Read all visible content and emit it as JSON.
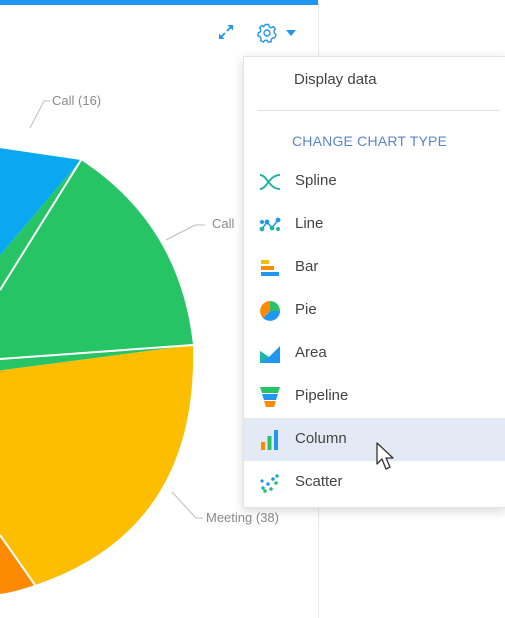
{
  "toolbar": {
    "expand_icon": "expand-icon",
    "settings_icon": "gear-icon",
    "dropdown_icon": "caret-down-icon",
    "accent_color": "#2196f3"
  },
  "chart_data": {
    "type": "pie",
    "labels": [
      "Call (16)",
      "Call",
      "Meeting (38)"
    ],
    "slices": [
      {
        "name": "Call (16)",
        "color": "#0aa8f0"
      },
      {
        "name": "Call",
        "color": "#27c465"
      },
      {
        "name": "Meeting (38)",
        "color": "#fdbd00"
      },
      {
        "name": "",
        "color": "#fd8a00"
      }
    ]
  },
  "menu": {
    "display_data": "Display data",
    "heading": "CHANGE CHART TYPE",
    "items": [
      {
        "label": "Spline",
        "icon": "spline-icon"
      },
      {
        "label": "Line",
        "icon": "line-icon"
      },
      {
        "label": "Bar",
        "icon": "bar-icon"
      },
      {
        "label": "Pie",
        "icon": "pie-icon"
      },
      {
        "label": "Area",
        "icon": "area-icon"
      },
      {
        "label": "Pipeline",
        "icon": "pipeline-icon"
      },
      {
        "label": "Column",
        "icon": "column-icon",
        "hovered": true
      },
      {
        "label": "Scatter",
        "icon": "scatter-icon"
      }
    ]
  }
}
